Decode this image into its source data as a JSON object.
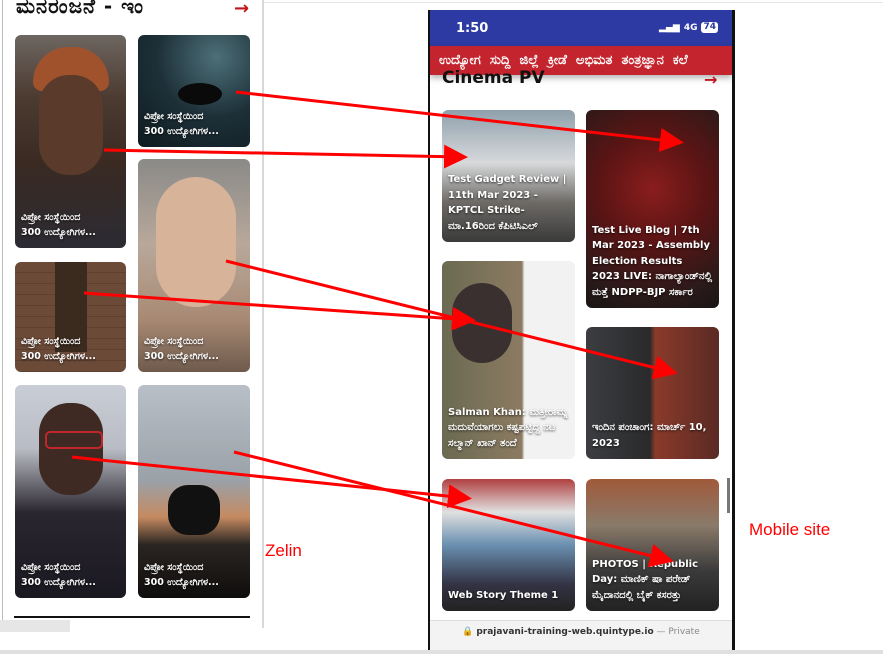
{
  "left_panel": {
    "section_title": "ಮನರಂಜನೆ - ಇಂ",
    "arrow": "→",
    "cards": [
      {
        "caption_line1": "ವಿಪ್ರೋ ಸಂಸ್ಥೆಯಿಂದ",
        "caption_line2": "300 ಉದ್ಯೋಗಿಗಳ...",
        "image": "young-man-portrait"
      },
      {
        "caption_line1": "ವಿಪ್ರೋ ಸಂಸ್ಥೆಯಿಂದ",
        "caption_line2": "300 ಉದ್ಯೋಗಿಗಳ...",
        "image": "night-sky-milky-way"
      },
      {
        "caption_line1": "ವಿಪ್ರೋ ಸಂಸ್ಥೆಯಿಂದ",
        "caption_line2": "300 ಉದ್ಯೋಗಿಗಳ...",
        "image": "woman-shaved-head"
      },
      {
        "caption_line1": "ವಿಪ್ರೋ ಸಂಸ್ಥೆಯಿಂದ",
        "caption_line2": "300 ಉದ್ಯೋಗಿಗಳ...",
        "image": "wooden-door"
      },
      {
        "caption_line1": "ವಿಪ್ರೋ ಸಂಸ್ಥೆಯಿಂದ",
        "caption_line2": "300 ಉದ್ಯೋಗಿಗಳ...",
        "image": "man-red-glasses"
      },
      {
        "caption_line1": "ವಿಪ್ರೋ ಸಂಸ್ಥೆಯಿಂದ",
        "caption_line2": "300 ಉದ್ಯೋಗಿಗಳ...",
        "image": "motorcycle-sunset"
      }
    ],
    "annotation_label": "Zelin"
  },
  "mobile": {
    "status_bar": {
      "time": "1:50",
      "signal": "4G",
      "battery": "74"
    },
    "nav_items": [
      "ಉದ್ಯೋಗ",
      "ಸುದ್ದಿ",
      "ಜಿಲ್ಲೆ",
      "ಕ್ರೀಡೆ",
      "ಅಭಿಮತ",
      "ತಂತ್ರಜ್ಞಾನ",
      "ಕಲೆ"
    ],
    "section_title": "Cinema PV",
    "arrow": "→",
    "cards": [
      {
        "caption": "Test Gadget Review | 11th Mar 2023 - KPTCL Strike- ಮಾ.16ರಿಂದ ಕೆಪಿಟಿಸಿಎಲ್",
        "image": "traffic-street"
      },
      {
        "caption": "Test Live Blog | 7th Mar 2023 - Assembly Election Results 2023 LIVE: ನಾಗಾಲ್ಯಾಂಡ್‌ನಲ್ಲಿ ಮತ್ತೆ NDPP-BJP ಸರ್ಕಾರ",
        "image": "assembly-hall"
      },
      {
        "caption": "Salman Khan: ಮತ್ತೀರಾಮ್ನ ಮದುವೆಯಾಗಲು ಕಷ್ಟಪಟ್ಟಿದ್ದ ನಟ ಸಲ್ಮಾನ್ ಖಾನ್ ತಂದೆ",
        "image": "cat"
      },
      {
        "caption": "ಇಂದಿನ ಪಂಚಾಂಗ: ಮಾರ್ಚ್ 10, 2023",
        "image": "movie-poster"
      },
      {
        "caption": "Web Story Theme 1",
        "image": "american-flag-couple"
      },
      {
        "caption": "PHOTOS | Republic Day: ಮಾಣಿಕ್ ಷಾ ಪರೇಡ್ ಮೈದಾನದಲ್ಲಿ ಬೈಕ್ ಕಸರತ್ತು",
        "image": "republic-day-salute"
      }
    ],
    "url_bar": {
      "url": "prajavani-training-web.quintype.io",
      "separator": " — ",
      "mode": "Private"
    },
    "annotation_label": "Mobile site"
  },
  "colors": {
    "nav_red": "#c3242d",
    "status_blue": "#2d3aa3",
    "annotation_red": "#ff0000"
  }
}
